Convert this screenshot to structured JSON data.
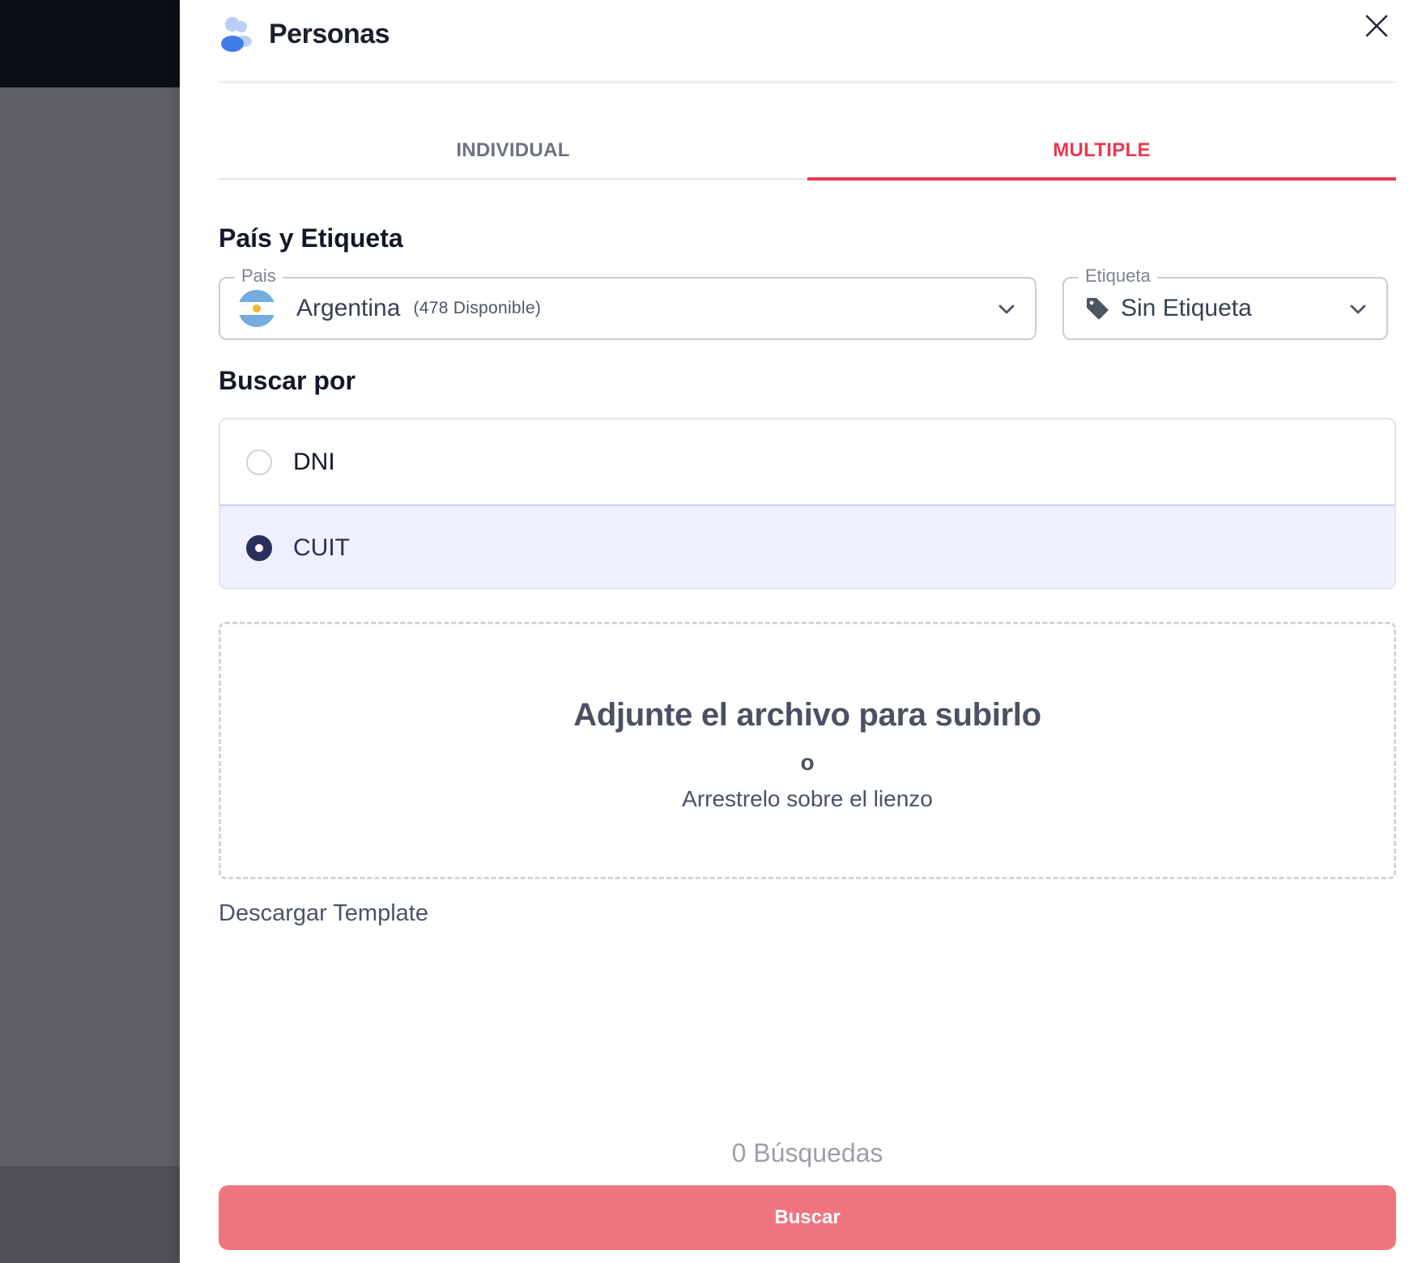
{
  "header": {
    "title": "Personas",
    "close_icon": "close-icon",
    "people_icon": "users-icon"
  },
  "tabs": [
    {
      "label": "INDIVIDUAL",
      "active": false
    },
    {
      "label": "MULTIPLE",
      "active": true
    }
  ],
  "country_section": {
    "title": "País y Etiqueta",
    "country": {
      "legend": "Pais",
      "value": "Argentina",
      "available": "(478 Disponible)",
      "flag_icon": "argentina-flag-icon"
    },
    "tag": {
      "legend": "Etiqueta",
      "value": "Sin Etiqueta",
      "icon": "tag-icon"
    }
  },
  "search_by": {
    "title": "Buscar por",
    "options": [
      {
        "label": "DNI",
        "selected": false
      },
      {
        "label": "CUIT",
        "selected": true
      }
    ]
  },
  "dropzone": {
    "title": "Adjunte el archivo para subirlo",
    "or": "o",
    "subtitle": "Arrestrelo sobre el lienzo"
  },
  "download_template": "Descargar Template",
  "search_count": "0 Búsquedas",
  "search_button": "Buscar",
  "colors": {
    "accent": "#e8394f",
    "button": "#ee7580",
    "selected_bg": "#eef0fd",
    "radio_selected": "#2b2f5c"
  }
}
